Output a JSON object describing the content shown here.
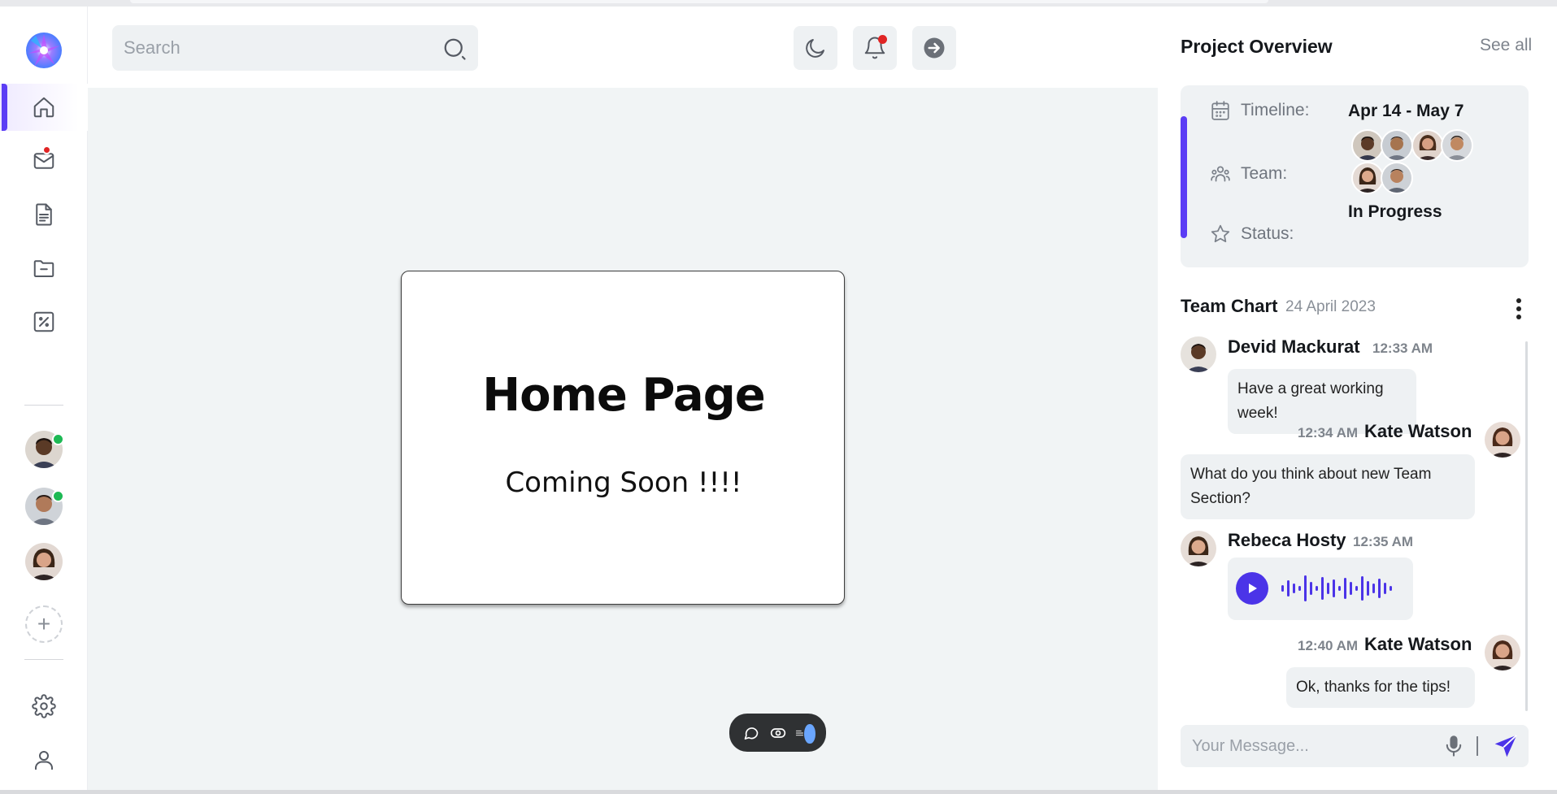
{
  "search": {
    "placeholder": "Search"
  },
  "project_overview": {
    "title": "Project Overview",
    "see_all": "See all",
    "timeline_label": "Timeline:",
    "timeline_value": "Apr 14 - May 7",
    "team_label": "Team:",
    "status_label": "Status:",
    "status_value": "In Progress"
  },
  "home": {
    "title": "Home Page",
    "subtitle": "Coming Soon !!!!"
  },
  "team_chat": {
    "title": "Team Chart",
    "date": "24 April 2023",
    "messages": [
      {
        "name": "Devid Mackurat",
        "time": "12:33 AM",
        "text": "Have a great working week!"
      },
      {
        "name": "Kate Watson",
        "time": "12:34 AM",
        "text": "What do you think about new Team Section?"
      },
      {
        "name": "Rebeca Hosty",
        "time": "12:35 AM",
        "text": ""
      },
      {
        "name": "Kate Watson",
        "time": "12:40 AM",
        "text": "Ok, thanks for the tips!"
      }
    ]
  },
  "composer": {
    "placeholder": "Your Message..."
  },
  "colors": {
    "accent": "#5b3df5",
    "voice": "#4b34e8",
    "online": "#1db954",
    "notify": "#e02424"
  },
  "icons": [
    "logo",
    "home-icon",
    "mail-icon",
    "document-icon",
    "folder-icon",
    "percent-icon",
    "gear-icon",
    "user-icon",
    "search-icon",
    "moon-icon",
    "bell-icon",
    "arrow-right-circle-icon",
    "calendar-icon",
    "team-icon",
    "star-icon",
    "more-vertical-icon",
    "play-icon",
    "mic-icon",
    "send-icon",
    "chat-bubble-icon",
    "eye-icon",
    "list-icon"
  ]
}
